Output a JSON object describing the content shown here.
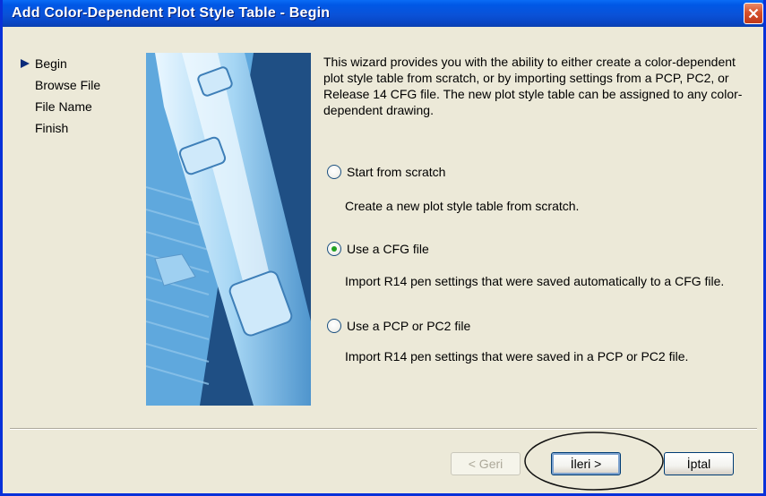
{
  "window": {
    "title": "Add Color-Dependent Plot Style Table - Begin"
  },
  "steps": [
    {
      "label": "Begin",
      "current": true
    },
    {
      "label": "Browse File",
      "current": false
    },
    {
      "label": "File Name",
      "current": false
    },
    {
      "label": "Finish",
      "current": false
    }
  ],
  "intro": "This wizard provides you with the ability to either create a color-dependent plot style table from scratch, or by importing settings from a PCP, PC2, or Release 14 CFG file. The new plot style table can be assigned to any color-dependent drawing.",
  "options": [
    {
      "label": "Start from scratch",
      "description": "Create a new plot style table from scratch.",
      "selected": false
    },
    {
      "label": "Use a CFG file",
      "description": "Import R14 pen settings that were saved automatically to a CFG file.",
      "selected": true
    },
    {
      "label": "Use a PCP or PC2 file",
      "description": "Import R14 pen settings that were saved in a PCP or PC2 file.",
      "selected": false
    }
  ],
  "buttons": {
    "back": "< Geri",
    "next": "İleri >",
    "cancel": "İptal"
  },
  "colors": {
    "titlebar": "#0a52d8",
    "dialog_bg": "#ece9d8",
    "radio_check": "#21a121",
    "close_button": "#d5512b"
  },
  "icons": {
    "step_marker": "triangle-right-icon",
    "close": "close-icon"
  }
}
